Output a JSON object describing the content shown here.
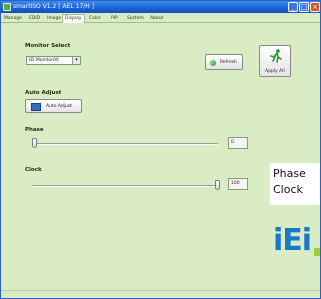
{
  "window": {
    "title": "smartISO V1.2 [ AEL 17/H ]",
    "controls": [
      "_",
      "□",
      "×"
    ]
  },
  "tabs": [
    {
      "label": "Manage"
    },
    {
      "label": "EDID"
    },
    {
      "label": "Image"
    },
    {
      "label": "Display",
      "active": true
    },
    {
      "label": "Color"
    },
    {
      "label": "PIP"
    },
    {
      "label": "System"
    },
    {
      "label": "About"
    }
  ],
  "monitor_select": {
    "label": "Monitor Select",
    "selected": "IEI Monitor00"
  },
  "refresh_button": {
    "label": "Refresh"
  },
  "apply_button": {
    "label": "Apply All"
  },
  "auto_adjust": {
    "label": "Auto Adjust",
    "button_label": "Auto Adjust"
  },
  "phase": {
    "label": "Phase",
    "value": "0",
    "level": 0.0
  },
  "clock": {
    "label": "Clock",
    "value": "100",
    "level": 1.0
  },
  "annotation": {
    "line1": "Phase",
    "line2": "Clock"
  },
  "logo": {
    "text": "iEi"
  },
  "colors": {
    "panel_bg": "#d9ecc4",
    "titlebar": "#1c5fd6",
    "logo_blue": "#1a78c8",
    "logo_green": "#9ccc3a"
  },
  "icons": {
    "refresh": "green-circle-icon",
    "apply": "running-man-icon",
    "auto_adjust": "monitor-icon"
  }
}
